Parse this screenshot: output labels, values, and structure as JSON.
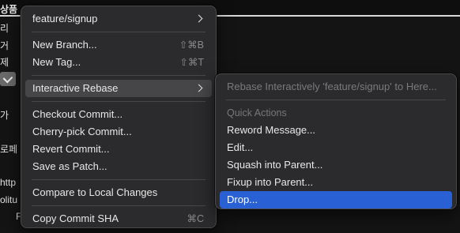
{
  "background": {
    "title_fragment": "상품 ∶",
    "fragments": [
      "리",
      "거",
      "제",
      "가",
      "로페",
      "http",
      "olitu",
      "F"
    ]
  },
  "context_menu": {
    "items": [
      {
        "label": "feature/signup",
        "has_submenu": true
      },
      {
        "label": "New Branch...",
        "shortcut": "⇧⌘B"
      },
      {
        "label": "New Tag...",
        "shortcut": "⇧⌘T"
      },
      {
        "label": "Interactive Rebase",
        "has_submenu": true,
        "highlighted": true
      },
      {
        "label": "Checkout Commit..."
      },
      {
        "label": "Cherry-pick Commit..."
      },
      {
        "label": "Revert Commit..."
      },
      {
        "label": "Save as Patch..."
      },
      {
        "label": "Compare to Local Changes"
      },
      {
        "label": "Copy Commit SHA",
        "shortcut": "⌘C"
      }
    ]
  },
  "rebase_submenu": {
    "header": "Rebase Interactively 'feature/signup' to Here...",
    "section_label": "Quick Actions",
    "items": [
      {
        "label": "Reword Message..."
      },
      {
        "label": "Edit..."
      },
      {
        "label": "Squash into Parent..."
      },
      {
        "label": "Fixup into Parent..."
      },
      {
        "label": "Drop...",
        "selected": true
      }
    ]
  },
  "colors": {
    "menu_bg": "#2b2b2d",
    "highlight": "#464649",
    "selection": "#2960d4",
    "text": "#e8e8e8",
    "disabled_text": "#7a7a7c"
  }
}
